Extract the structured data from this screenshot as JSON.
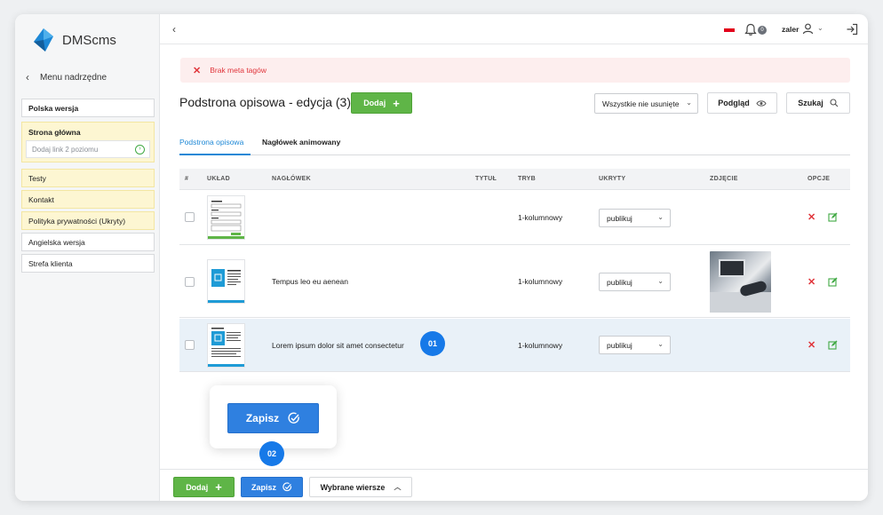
{
  "app": {
    "logo_text": "DMScms"
  },
  "sidebar": {
    "back_label": "Menu nadrzędne",
    "items": [
      {
        "label": "Polska wersja"
      },
      {
        "label": "Strona główna",
        "input_placeholder": "Dodaj link 2 poziomu"
      },
      {
        "label": "Testy"
      },
      {
        "label": "Kontakt"
      },
      {
        "label": "Polityka prywatności (Ukryty)"
      },
      {
        "label": "Angielska wersja"
      },
      {
        "label": "Strefa klienta"
      }
    ]
  },
  "topbar": {
    "notifications_count": "0",
    "user_name": "zaler"
  },
  "alert": {
    "message": "Brak meta tagów"
  },
  "page": {
    "title": "Podstrona opisowa - edycja (3)",
    "add_label": "Dodaj",
    "filter_value": "Wszystkie nie usunięte",
    "preview_label": "Podgląd",
    "search_label": "Szukaj"
  },
  "tabs": [
    {
      "label": "Podstrona opisowa"
    },
    {
      "label": "Nagłówek animowany"
    }
  ],
  "table": {
    "headers": [
      "#",
      "UKŁAD",
      "NAGŁÓWEK",
      "TYTUŁ",
      "TRYB",
      "UKRYTY",
      "ZDJĘCIE",
      "OPCJE"
    ],
    "rows": [
      {
        "heading": "",
        "mode": "1-kolumnowy",
        "hidden": "publikuj"
      },
      {
        "heading": "Tempus leo eu aenean",
        "mode": "1-kolumnowy",
        "hidden": "publikuj"
      },
      {
        "heading": "Lorem ipsum dolor sit amet consectetur",
        "mode": "1-kolumnowy",
        "hidden": "publikuj"
      }
    ]
  },
  "callouts": {
    "first": "01",
    "second": "02"
  },
  "float": {
    "save_label": "Zapisz"
  },
  "bottombar": {
    "add_label": "Dodaj",
    "save_label": "Zapisz",
    "selected_label": "Wybrane wiersze"
  },
  "colors": {
    "green": "#5fb547",
    "blue": "#2f80e0",
    "red": "#e0353b",
    "highlight": "#e9f1f8"
  }
}
